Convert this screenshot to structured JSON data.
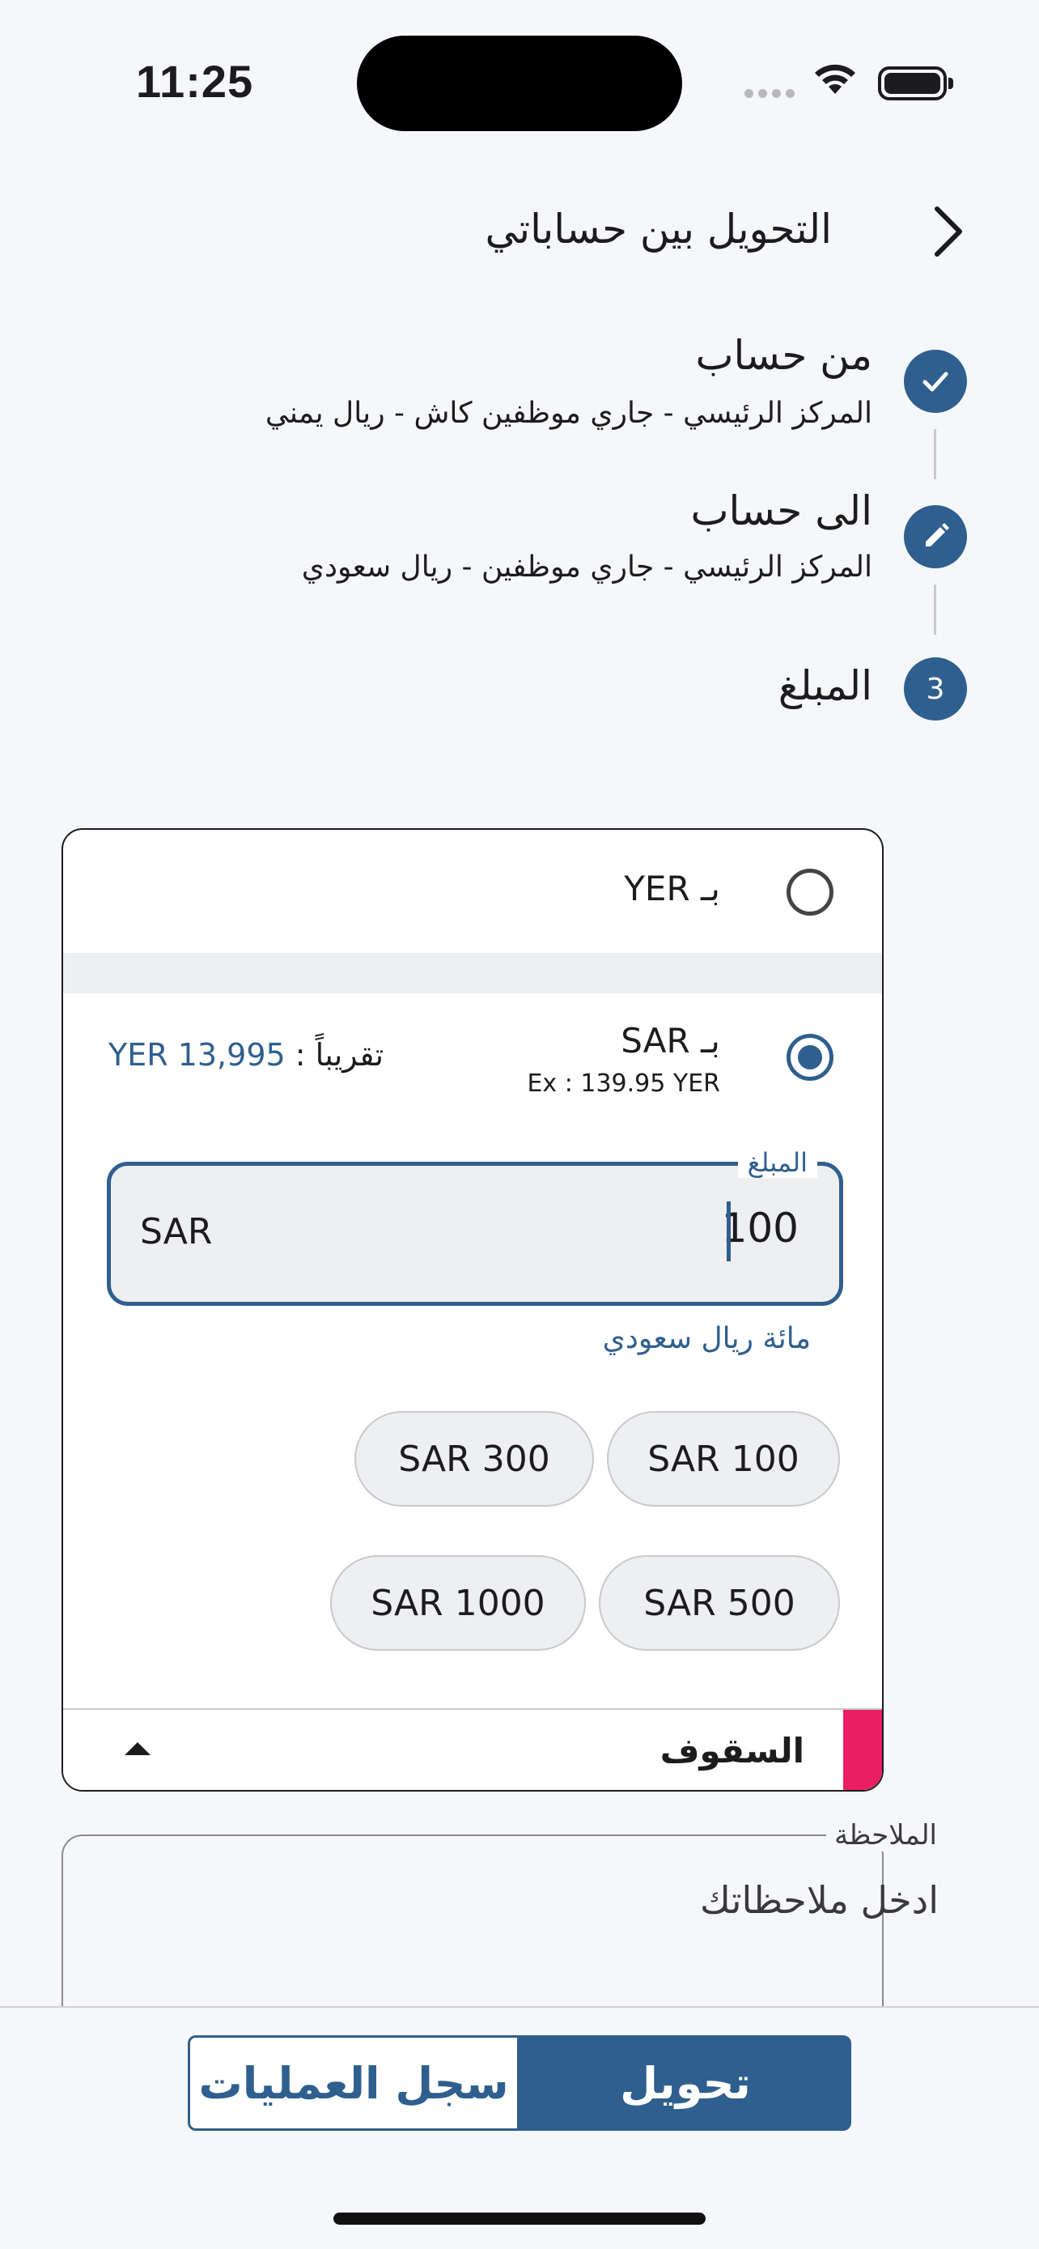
{
  "status_bar": {
    "time": "11:25"
  },
  "header": {
    "title": "التحويل بين حساباتي",
    "back_icon": "chevron-right-icon"
  },
  "steps": [
    {
      "number": "",
      "icon": "check-icon",
      "title": "من حساب",
      "subtitle": "المركز الرئيسي - جاري  موظفين كاش - ريال يمني"
    },
    {
      "number": "",
      "icon": "pencil-icon",
      "title": "الى حساب",
      "subtitle": "المركز الرئيسي - جاري موظفين - ريال سعودي"
    },
    {
      "number": "3",
      "icon": "",
      "title": "المبلغ",
      "subtitle": ""
    }
  ],
  "currency_options": [
    {
      "label": "بـ YER",
      "selected": false
    },
    {
      "label": "بـ SAR",
      "selected": true,
      "exchange": "Ex : 139.95 YER",
      "approx_label": "تقريباً :",
      "approx_value": "YER 13,995"
    }
  ],
  "amount": {
    "label": "المبلغ",
    "value": "100",
    "unit": "SAR",
    "in_words": "مائة ريال سعودي"
  },
  "quick_amounts": [
    "SAR 100",
    "SAR 300",
    "SAR 500",
    "SAR 1000"
  ],
  "limits": {
    "label": "السقوف"
  },
  "notes": {
    "label": "الملاحظة",
    "placeholder": "ادخل ملاحظاتك"
  },
  "actions": {
    "transfer": "تحويل",
    "history": "سجل العمليات"
  },
  "colors": {
    "primary": "#2f5f8e",
    "accent": "#e91e63",
    "background": "#f6f7fb"
  }
}
